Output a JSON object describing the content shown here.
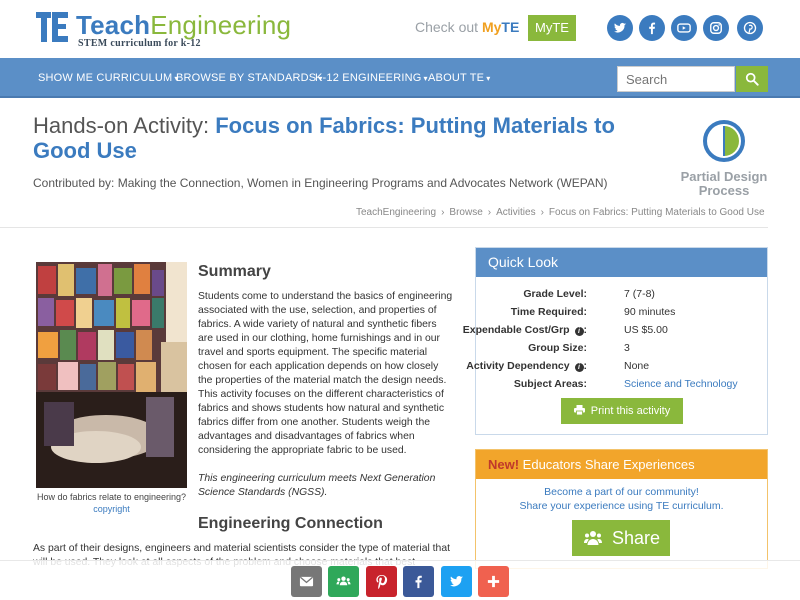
{
  "header": {
    "logo_word1": "Teach",
    "logo_word2": "Engineering",
    "logo_tagline": "STEM curriculum for k-12",
    "checkout_prefix": "Check out ",
    "checkout_my": "My",
    "checkout_te": "TE",
    "myte_button": "MyTE",
    "social": [
      "twitter-icon",
      "facebook-icon",
      "youtube-icon",
      "instagram-icon",
      "pinterest-icon"
    ]
  },
  "nav": {
    "items": [
      {
        "label": "SHOW ME CURRICULUM"
      },
      {
        "label": "BROWSE BY STANDARDS"
      },
      {
        "label": "K-12 ENGINEERING"
      },
      {
        "label": "ABOUT TE"
      }
    ],
    "caret": "▾",
    "search_placeholder": "Search"
  },
  "page": {
    "title_prefix": "Hands-on Activity: ",
    "title_main": "Focus on Fabrics: Putting Materials to Good Use",
    "contributed": "Contributed by: Making the Connection, Women in Engineering Programs and Advocates Network (WEPAN)",
    "design_process_line1": "Partial Design",
    "design_process_line2": "Process"
  },
  "breadcrumb": [
    "TeachEngineering",
    "Browse",
    "Activities",
    "Focus on Fabrics: Putting Materials to Good Use"
  ],
  "image": {
    "caption": "How do fabrics relate to engineering?",
    "credit": "copyright"
  },
  "summary": {
    "heading": "Summary",
    "body": "Students come to understand the basics of engineering associated with the use, selection, and properties of fabrics. A wide variety of natural and synthetic fibers are used in our clothing, home furnishings and in our travel and sports equipment. The specific material chosen for each application depends on how closely the properties of the material match the design needs. This activity focuses on the different characteristics of fabrics and shows students how natural and synthetic fabrics differ from one another. Students weigh the advantages and disadvantages of fabrics when considering the appropriate fabric to be used.",
    "ngss_note": "This engineering curriculum meets Next Generation Science Standards (NGSS)."
  },
  "engineering": {
    "heading": "Engineering Connection",
    "body": "As part of their designs, engineers and material scientists consider the type of material that will be used. They look at all aspects of the problem and choose materials that best"
  },
  "quick_look": {
    "title": "Quick Look",
    "rows": [
      {
        "label": "Grade Level:",
        "value": "7 (7-8)"
      },
      {
        "label": "Time Required:",
        "value": "90 minutes"
      },
      {
        "label": "Expendable Cost/Grp",
        "value": "US $5.00"
      },
      {
        "label": "Group Size:",
        "value": "3"
      },
      {
        "label": "Activity Dependency",
        "value": "None"
      },
      {
        "label": "Subject Areas:",
        "value": "Science and Technology"
      }
    ],
    "colon": ":",
    "info_glyph": "i",
    "print_button": "Print this activity"
  },
  "educators": {
    "new_label": "New!",
    "title": " Educators Share Experiences",
    "line1": "Become a part of our community!",
    "line2": "Share your experience using TE curriculum.",
    "share_button": "Share"
  },
  "float_share": {
    "buttons": [
      {
        "name": "email",
        "color": "#777777"
      },
      {
        "name": "google-classroom",
        "color": "#2fa85a"
      },
      {
        "name": "pinterest",
        "color": "#c8232c"
      },
      {
        "name": "facebook",
        "color": "#3b5998"
      },
      {
        "name": "twitter",
        "color": "#1da1f2"
      },
      {
        "name": "more",
        "color": "#f0614f"
      }
    ]
  },
  "colors": {
    "brand_blue": "#3b7bbf",
    "nav_blue": "#5b8fc7",
    "brand_green": "#8ab83c",
    "accent_orange": "#f2a52b"
  }
}
